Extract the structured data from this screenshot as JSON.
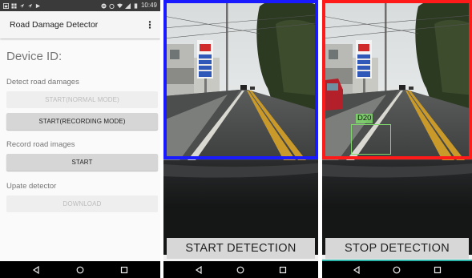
{
  "app": {
    "status_time": "10:49",
    "title": "Road Damage Detector",
    "overflow_icon": "⋮",
    "device_id_label": "Device ID:",
    "sections": {
      "detect_label": "Detect road damages",
      "normal_mode_button": "START(NORMAL MODE)",
      "recording_mode_button": "START(RECORDING MODE)",
      "record_label": "Record road images",
      "record_start_button": "START",
      "update_label": "Upate detector",
      "download_button": "DOWNLOAD"
    }
  },
  "detection_screens": {
    "start_button": "START DETECTION",
    "stop_button": "STOP DETECTION",
    "idle_frame_color": "#1a1aff",
    "active_frame_color": "#ff1a1a",
    "detection_label": "D20",
    "detection_box_color": "#7ed86b"
  },
  "navigation": {
    "back_icon": "triangle-back-icon",
    "home_icon": "circle-home-icon",
    "recents_icon": "square-recents-icon"
  },
  "colors": {
    "status_bar": "#3a3a3a",
    "nav_bar": "#000000",
    "accent_line": "#2bb5a8",
    "button_enabled": "#d6d6d6",
    "button_disabled": "#eeeeee"
  }
}
